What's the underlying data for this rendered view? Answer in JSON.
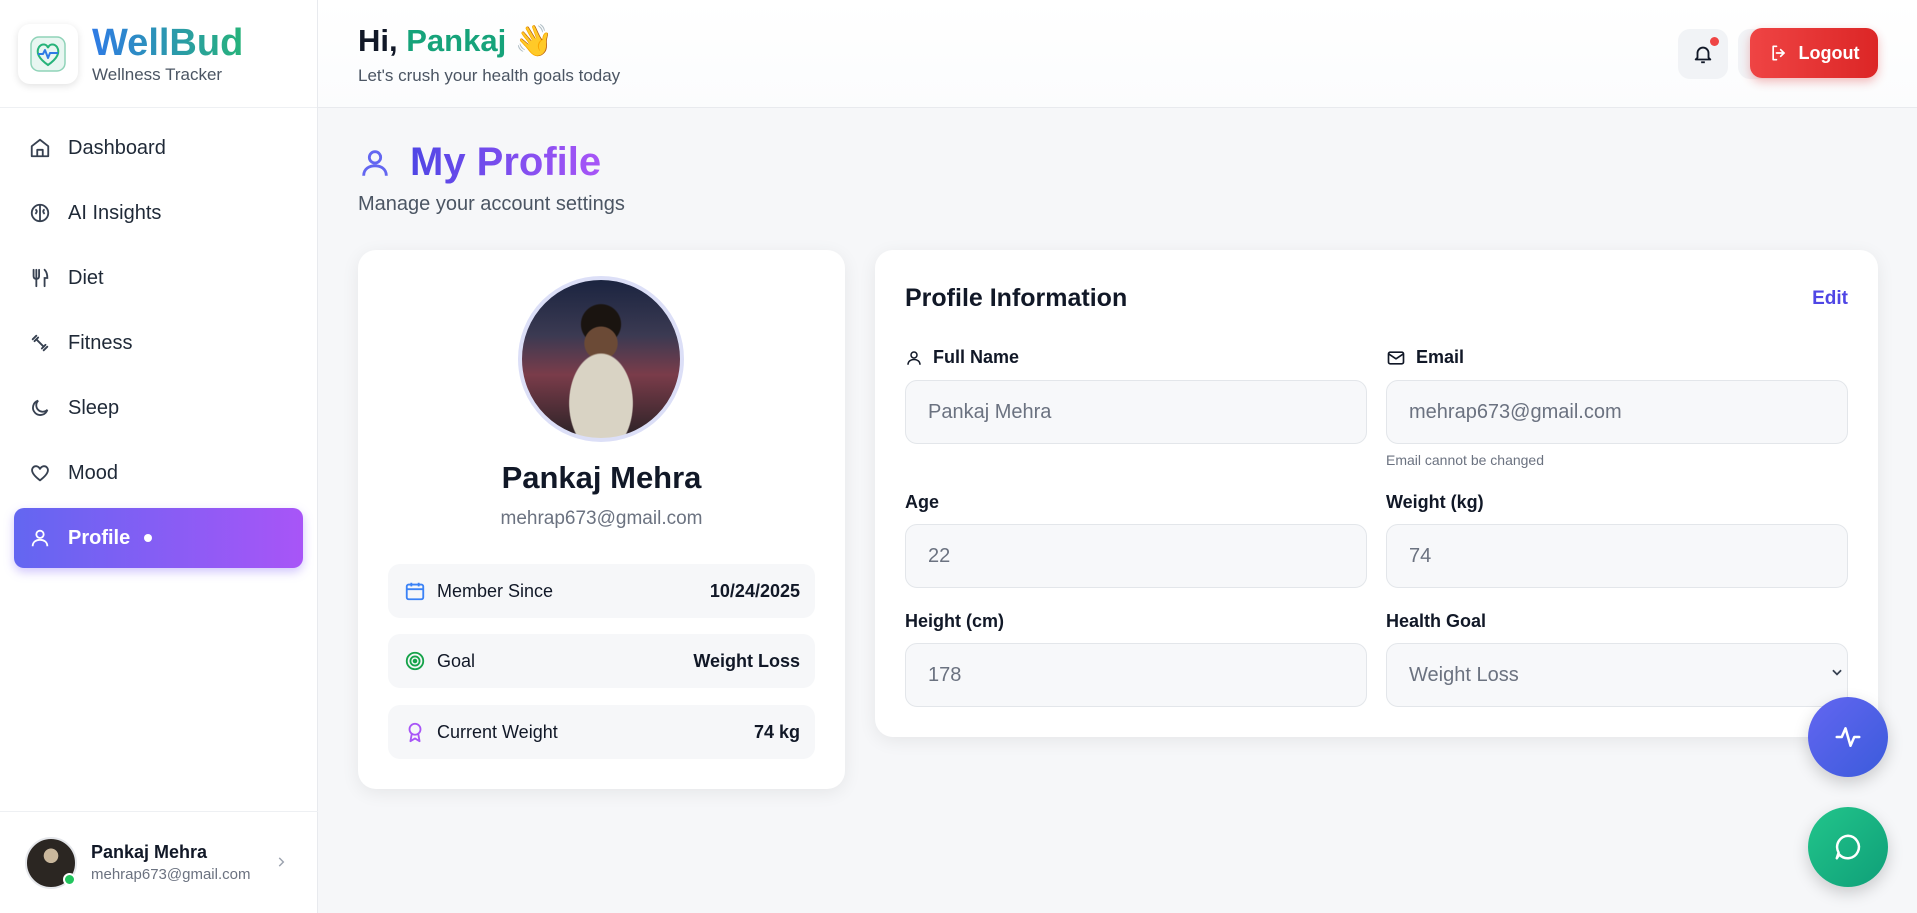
{
  "brand": {
    "name": "WellBud",
    "subtitle": "Wellness Tracker"
  },
  "sidebar": {
    "items": [
      {
        "label": "Dashboard",
        "icon": "home-icon"
      },
      {
        "label": "AI Insights",
        "icon": "brain-icon"
      },
      {
        "label": "Diet",
        "icon": "utensils-icon"
      },
      {
        "label": "Fitness",
        "icon": "dumbbell-icon"
      },
      {
        "label": "Sleep",
        "icon": "moon-icon"
      },
      {
        "label": "Mood",
        "icon": "heart-icon"
      },
      {
        "label": "Profile",
        "icon": "user-icon",
        "active": true
      }
    ]
  },
  "footer_user": {
    "name": "Pankaj Mehra",
    "email": "mehrap673@gmail.com"
  },
  "header": {
    "greeting_prefix": "Hi,",
    "greeting_name": "Pankaj",
    "greeting_emoji": "👋",
    "subtitle": "Let's crush your health goals today",
    "logout_label": "Logout"
  },
  "page": {
    "title": "My Profile",
    "subtitle": "Manage your account settings"
  },
  "profile_card": {
    "name": "Pankaj Mehra",
    "email": "mehrap673@gmail.com",
    "stats": [
      {
        "label": "Member Since",
        "value": "10/24/2025",
        "icon": "calendar-icon"
      },
      {
        "label": "Goal",
        "value": "Weight Loss",
        "icon": "target-icon"
      },
      {
        "label": "Current Weight",
        "value": "74 kg",
        "icon": "award-icon"
      }
    ]
  },
  "profile_info": {
    "title": "Profile Information",
    "edit_label": "Edit",
    "full_name_label": "Full Name",
    "full_name_value": "Pankaj Mehra",
    "email_label": "Email",
    "email_value": "mehrap673@gmail.com",
    "email_hint": "Email cannot be changed",
    "age_label": "Age",
    "age_value": "22",
    "weight_label": "Weight (kg)",
    "weight_value": "74",
    "height_label": "Height (cm)",
    "height_value": "178",
    "goal_label": "Health Goal",
    "goal_value": "Weight Loss"
  },
  "colors": {
    "accent": "#6366f1",
    "accent_purple": "#a855f7",
    "green": "#16a37a",
    "danger": "#ef4444"
  }
}
